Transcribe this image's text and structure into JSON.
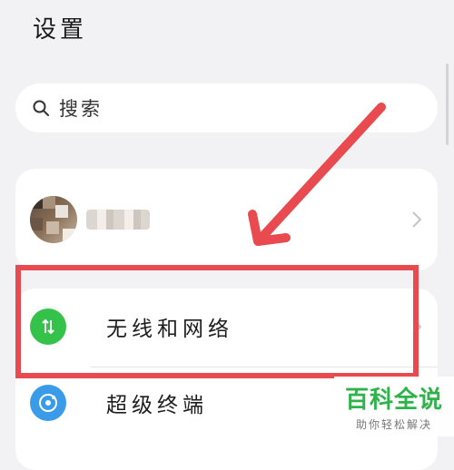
{
  "header": {
    "title": "设置"
  },
  "search": {
    "placeholder": "搜索",
    "icon": "search-icon"
  },
  "profile": {
    "avatar_icon": "avatar",
    "chevron": "chevron-right-icon"
  },
  "list": {
    "items": [
      {
        "label": "无线和网络",
        "icon": "network-icon",
        "icon_color": "#35c24a"
      },
      {
        "label": "超级终端",
        "icon": "super-device-icon",
        "icon_color": "#3a9be8"
      }
    ]
  },
  "annotation": {
    "box_color": "#e84a4f",
    "arrow_color": "#e84a4f"
  },
  "watermark": {
    "title": "百科全说",
    "subtitle": "助你轻松解决"
  }
}
